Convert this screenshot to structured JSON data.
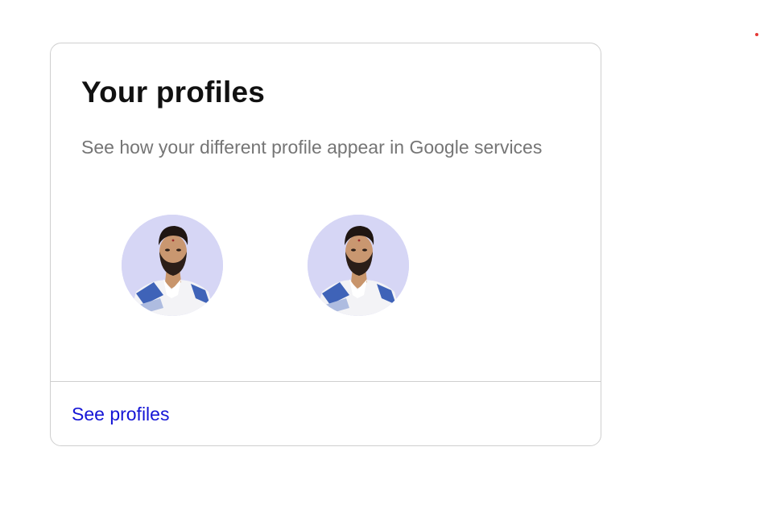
{
  "card": {
    "title": "Your profiles",
    "description": "See how your different profile appear in Google services",
    "profiles": [
      {
        "avatar": "profile-photo"
      },
      {
        "avatar": "profile-photo"
      }
    ],
    "footer_link": "See profiles"
  },
  "colors": {
    "link": "#1515d6",
    "avatar_background": "#d6d6f5",
    "description": "#757575"
  }
}
